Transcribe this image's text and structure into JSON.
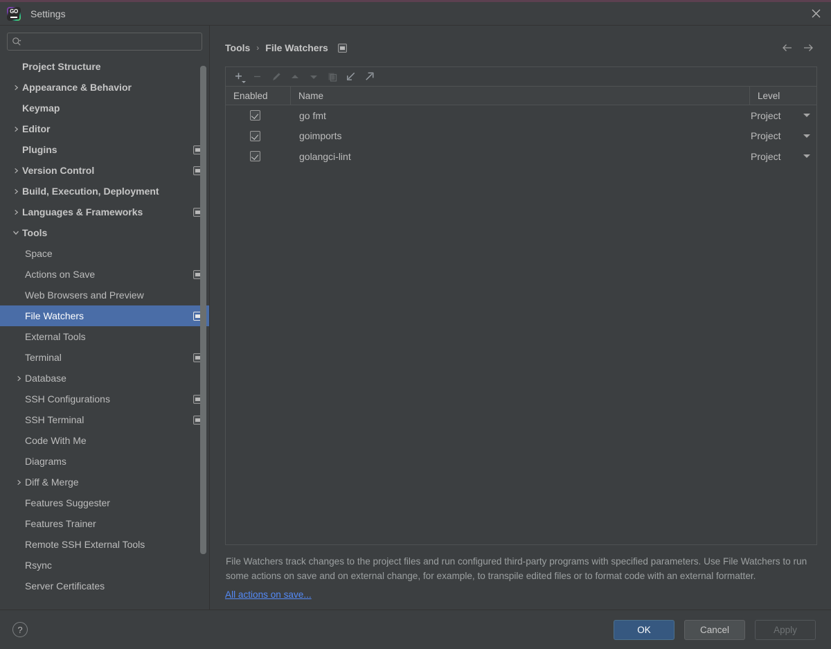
{
  "window": {
    "title": "Settings",
    "logo_icon": "goland-logo-icon",
    "close_icon": "close-icon",
    "accent_color": "#5c4050"
  },
  "search": {
    "value": "",
    "placeholder": "",
    "icon": "search-icon"
  },
  "sidebar": {
    "items": [
      {
        "label": "Project Structure",
        "level": 0,
        "arrow": "none",
        "badge": false
      },
      {
        "label": "Appearance & Behavior",
        "level": 0,
        "arrow": "chevron-right",
        "badge": false
      },
      {
        "label": "Keymap",
        "level": 0,
        "arrow": "none",
        "badge": false
      },
      {
        "label": "Editor",
        "level": 0,
        "arrow": "chevron-right",
        "badge": false
      },
      {
        "label": "Plugins",
        "level": 0,
        "arrow": "none",
        "badge": true
      },
      {
        "label": "Version Control",
        "level": 0,
        "arrow": "chevron-right",
        "badge": true
      },
      {
        "label": "Build, Execution, Deployment",
        "level": 0,
        "arrow": "chevron-right",
        "badge": false
      },
      {
        "label": "Languages & Frameworks",
        "level": 0,
        "arrow": "chevron-right",
        "badge": true
      },
      {
        "label": "Tools",
        "level": 0,
        "arrow": "chevron-down",
        "badge": false
      },
      {
        "label": "Space",
        "level": 1,
        "arrow": "none",
        "badge": false
      },
      {
        "label": "Actions on Save",
        "level": 1,
        "arrow": "none",
        "badge": true
      },
      {
        "label": "Web Browsers and Preview",
        "level": 1,
        "arrow": "none",
        "badge": false
      },
      {
        "label": "File Watchers",
        "level": 1,
        "arrow": "none",
        "badge": true,
        "selected": true
      },
      {
        "label": "External Tools",
        "level": 1,
        "arrow": "none",
        "badge": false
      },
      {
        "label": "Terminal",
        "level": 1,
        "arrow": "none",
        "badge": true
      },
      {
        "label": "Database",
        "level": 1,
        "arrow": "chevron-right",
        "badge": false
      },
      {
        "label": "SSH Configurations",
        "level": 1,
        "arrow": "none",
        "badge": true
      },
      {
        "label": "SSH Terminal",
        "level": 1,
        "arrow": "none",
        "badge": true
      },
      {
        "label": "Code With Me",
        "level": 1,
        "arrow": "none",
        "badge": false
      },
      {
        "label": "Diagrams",
        "level": 1,
        "arrow": "none",
        "badge": false
      },
      {
        "label": "Diff & Merge",
        "level": 1,
        "arrow": "chevron-right",
        "badge": false
      },
      {
        "label": "Features Suggester",
        "level": 1,
        "arrow": "none",
        "badge": false
      },
      {
        "label": "Features Trainer",
        "level": 1,
        "arrow": "none",
        "badge": false
      },
      {
        "label": "Remote SSH External Tools",
        "level": 1,
        "arrow": "none",
        "badge": false
      },
      {
        "label": "Rsync",
        "level": 1,
        "arrow": "none",
        "badge": false
      },
      {
        "label": "Server Certificates",
        "level": 1,
        "arrow": "none",
        "badge": false
      }
    ],
    "selected_label": "File Watchers",
    "selection_color": "#4a6da7",
    "scrollbar": {
      "thumb_top_pct": 2,
      "thumb_height_pct": 88
    }
  },
  "breadcrumb": {
    "parts": [
      "Tools",
      "File Watchers"
    ],
    "separator": "›",
    "badge_icon": "project-scope-icon",
    "back_icon": "arrow-left-icon",
    "forward_icon": "arrow-right-icon"
  },
  "toolbar": {
    "buttons": [
      {
        "name": "add-button",
        "icon": "plus-icon",
        "enabled": true,
        "has_dropdown": true
      },
      {
        "name": "remove-button",
        "icon": "minus-icon",
        "enabled": false,
        "has_dropdown": false
      },
      {
        "name": "edit-button",
        "icon": "pencil-icon",
        "enabled": false,
        "has_dropdown": false
      },
      {
        "name": "move-up-button",
        "icon": "arrow-up-icon",
        "enabled": false,
        "has_dropdown": false
      },
      {
        "name": "move-down-button",
        "icon": "arrow-down-icon",
        "enabled": false,
        "has_dropdown": false
      },
      {
        "name": "copy-button",
        "icon": "copy-icon",
        "enabled": false,
        "has_dropdown": false
      },
      {
        "name": "import-button",
        "icon": "import-arrow-icon",
        "enabled": true,
        "has_dropdown": false
      },
      {
        "name": "export-button",
        "icon": "export-arrow-icon",
        "enabled": true,
        "has_dropdown": false
      }
    ]
  },
  "table": {
    "columns": [
      "Enabled",
      "Name",
      "Level"
    ],
    "rows": [
      {
        "enabled": true,
        "name": "go fmt",
        "level": "Project"
      },
      {
        "enabled": true,
        "name": "goimports",
        "level": "Project"
      },
      {
        "enabled": true,
        "name": "golangci-lint",
        "level": "Project"
      }
    ]
  },
  "description": {
    "text": "File Watchers track changes to the project files and run configured third-party programs with specified parameters. Use File Watchers to run some actions on save and on external change, for example, to transpile edited files or to format code with an external formatter.",
    "link": "All actions on save...",
    "link_color": "#548af7"
  },
  "footer": {
    "help_label": "?",
    "help_icon": "help-icon",
    "buttons": [
      {
        "label": "OK",
        "style": "primary",
        "enabled": true
      },
      {
        "label": "Cancel",
        "style": "default",
        "enabled": true
      },
      {
        "label": "Apply",
        "style": "disabled",
        "enabled": false
      }
    ]
  }
}
